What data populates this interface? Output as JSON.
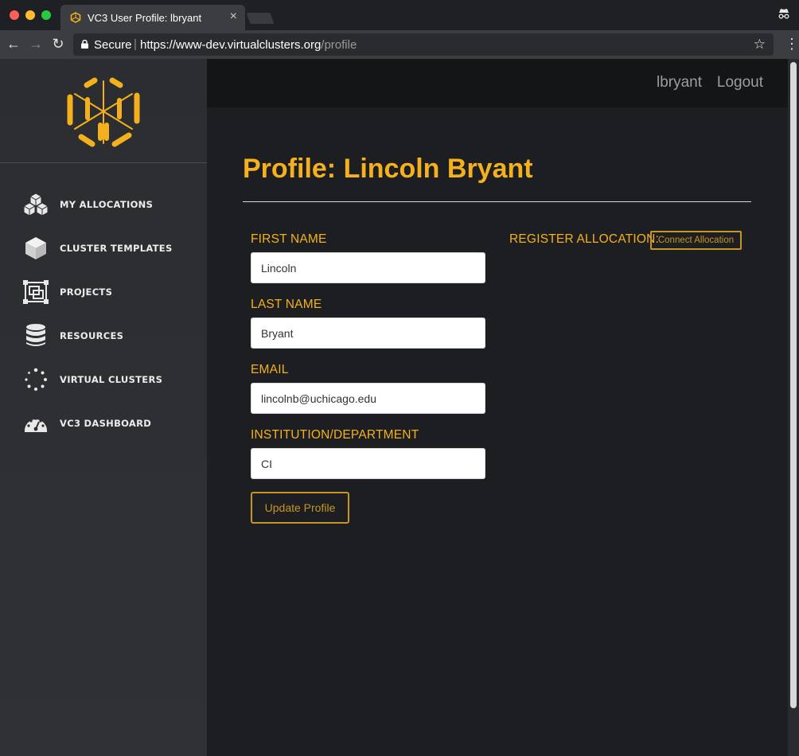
{
  "browser": {
    "tab_title": "VC3 User Profile: lbryant",
    "tab_close": "×",
    "secure_label": "Secure",
    "url_separator": "|",
    "url_host": "https://www-dev.virtualclusters.org",
    "url_path": "/profile"
  },
  "header": {
    "username": "lbryant",
    "logout": "Logout"
  },
  "sidebar": {
    "items": [
      {
        "label": "MY ALLOCATIONS",
        "icon": "cubes-icon"
      },
      {
        "label": "CLUSTER TEMPLATES",
        "icon": "cube-icon"
      },
      {
        "label": "PROJECTS",
        "icon": "projects-icon"
      },
      {
        "label": "RESOURCES",
        "icon": "database-icon"
      },
      {
        "label": "VIRTUAL CLUSTERS",
        "icon": "spinner-dots-icon"
      },
      {
        "label": "VC3 DASHBOARD",
        "icon": "dashboard-gauge-icon"
      }
    ]
  },
  "main": {
    "title": "Profile: Lincoln Bryant",
    "form": {
      "first_name_label": "FIRST NAME",
      "first_name_value": "Lincoln",
      "last_name_label": "LAST NAME",
      "last_name_value": "Bryant",
      "email_label": "EMAIL",
      "email_value": "lincolnb@uchicago.edu",
      "institution_label": "INSTITUTION/DEPARTMENT",
      "institution_value": "CI",
      "update_button": "Update Profile"
    },
    "register_allocation_label": "REGISTER ALLOCATION:",
    "connect_allocation_button": "Connect Allocation"
  },
  "colors": {
    "accent": "#f5b11d",
    "sidebar_bg": "#2b2d31",
    "content_bg": "#1d1e22",
    "topbar_bg": "#141517"
  }
}
